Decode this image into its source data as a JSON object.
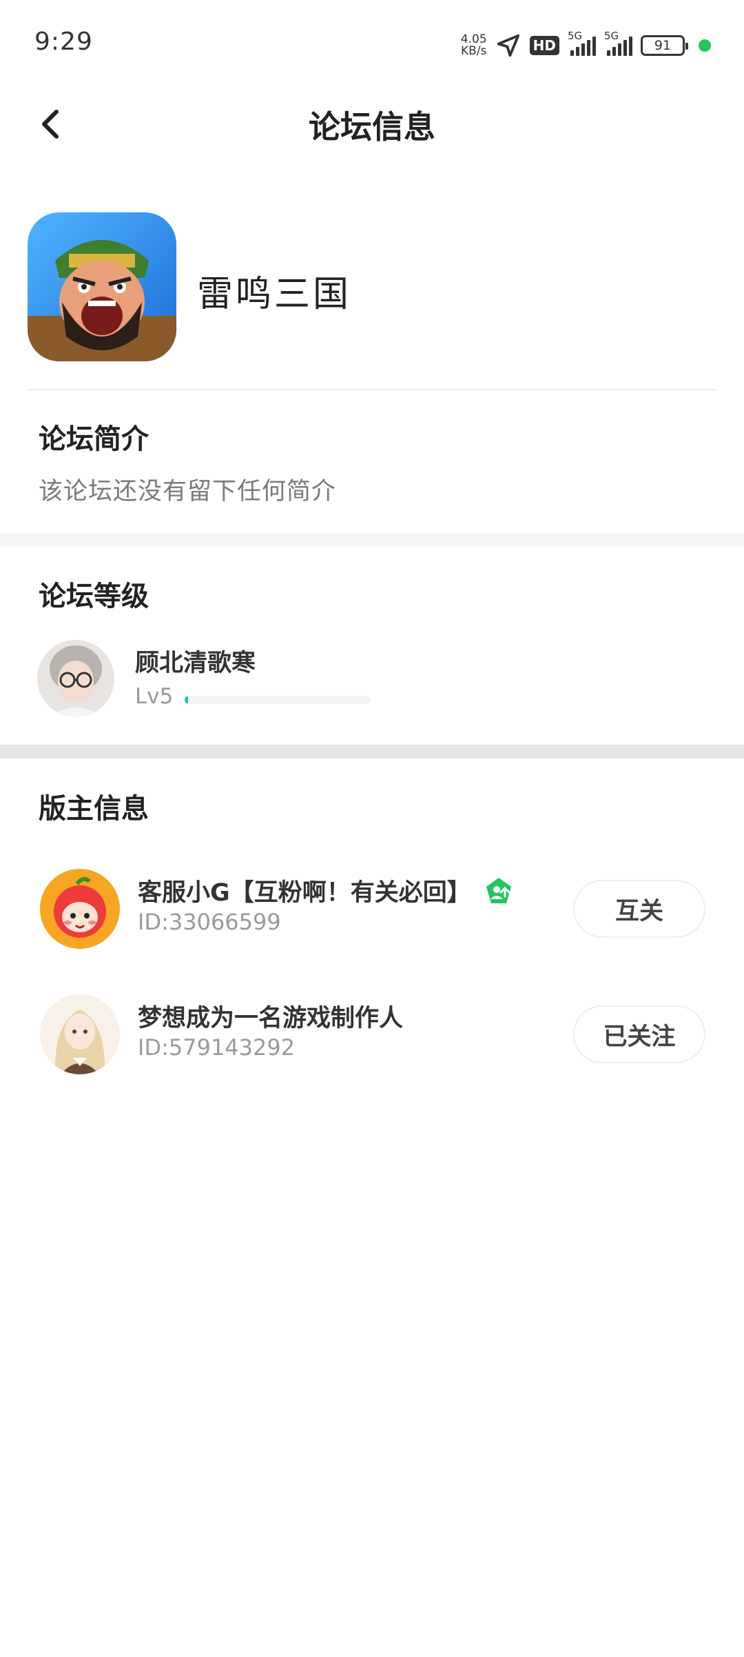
{
  "status_bar": {
    "time": "9:29",
    "net_speed_value": "4.05",
    "net_speed_unit": "KB/s",
    "hd_label": "HD",
    "sim1_label": "5G",
    "sim2_label": "5G",
    "battery": "91"
  },
  "header": {
    "title": "论坛信息"
  },
  "forum": {
    "name": "雷鸣三国"
  },
  "intro": {
    "title": "论坛简介",
    "text": "该论坛还没有留下任何简介"
  },
  "level": {
    "title": "论坛等级",
    "username": "顾北清歌寒",
    "level_label": "Lv5",
    "progress": 0.02
  },
  "moderators": {
    "title": "版主信息",
    "items": [
      {
        "name": "客服小G【互粉啊！有关必回】",
        "id": "ID:33066599",
        "button": "互关"
      },
      {
        "name": "梦想成为一名游戏制作人",
        "id": "ID:579143292",
        "button": "已关注"
      }
    ]
  },
  "colors": {
    "accent": "#22c5b6",
    "badge_green": "#22c55e",
    "divider": "#e3e7ea"
  }
}
